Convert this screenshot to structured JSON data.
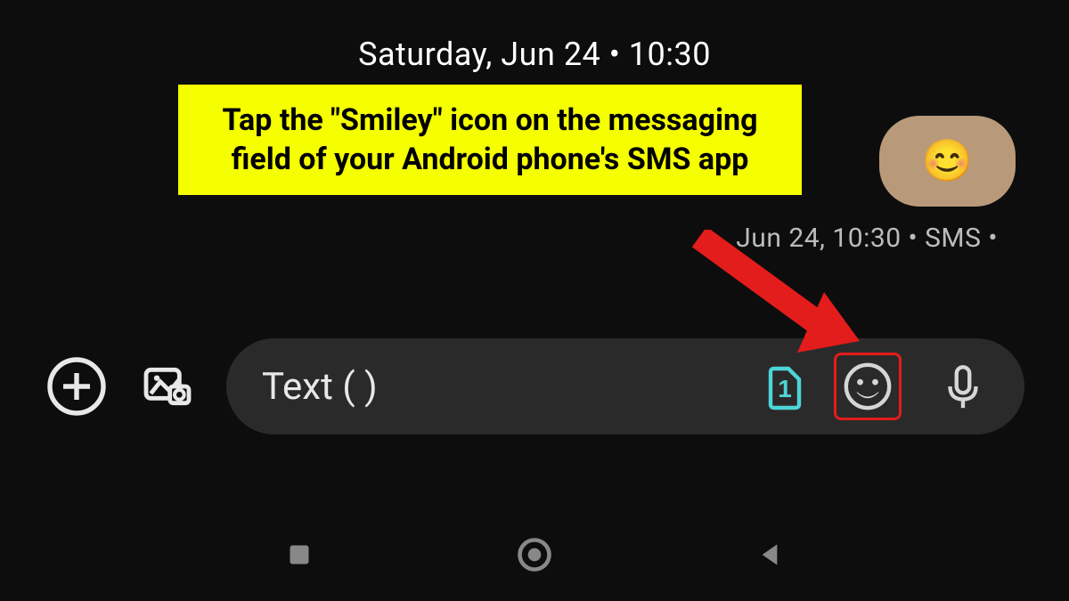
{
  "header": {
    "date_time": "Saturday, Jun 24 • 10:30"
  },
  "callout": {
    "text": "Tap the \"Smiley\" icon on the messaging field of your Android phone's SMS app"
  },
  "bubble": {
    "emoji": "😊"
  },
  "meta": {
    "text": "Jun 24, 10:30 • SMS •"
  },
  "input": {
    "placeholder": "Text (         )",
    "sim": "1"
  }
}
